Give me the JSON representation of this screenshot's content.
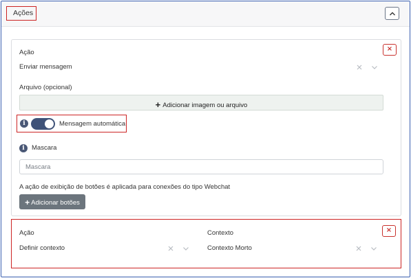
{
  "header": {
    "title": "Ações"
  },
  "action1": {
    "action_label": "Ação",
    "action_value": "Enviar mensagem",
    "remove_label": "×",
    "file_label": "Arquivo (opcional)",
    "upload_plus": "+",
    "upload_label": "Adicionar imagem ou arquivo",
    "auto_message_info": "i",
    "auto_message_toggle": true,
    "auto_message_label": "Mensagem automática",
    "mask_info": "i",
    "mask_label": "Mascara",
    "mask_placeholder": "Mascara",
    "buttons_note": "A ação de exibição de botões é aplicada para conexões do tipo Webchat",
    "add_buttons_plus": "+",
    "add_buttons_label": "Adicionar botões"
  },
  "action2": {
    "action_label": "Ação",
    "action_value": "Definir contexto",
    "context_label": "Contexto",
    "context_value": "Contexto Morto",
    "remove_label": "×"
  },
  "colors": {
    "accent": "#3f5278",
    "danger": "#c9302c",
    "highlight": "#cc2222",
    "secondary_button": "#6c757d",
    "upload_bg": "#eef2ef"
  },
  "icons": [
    "chevron-up-icon",
    "clear-icon",
    "chevron-down-icon",
    "remove-icon",
    "plus-icon",
    "info-icon"
  ]
}
